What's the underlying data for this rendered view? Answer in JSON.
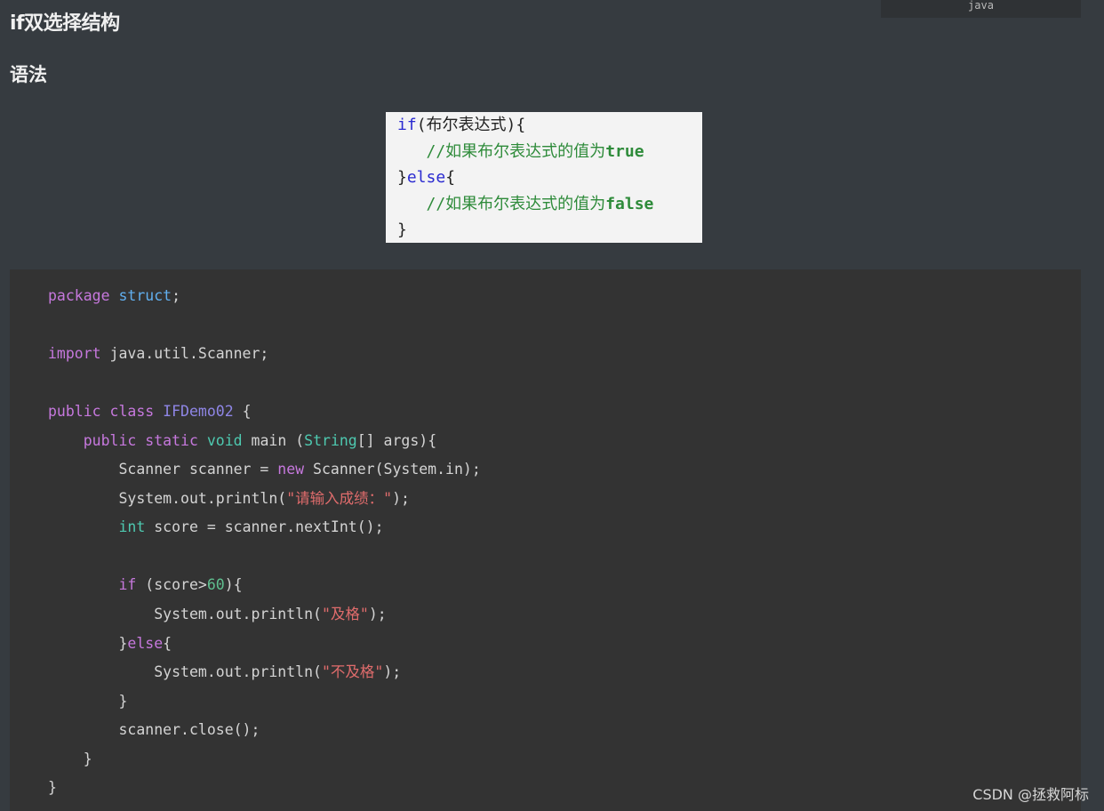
{
  "lang_label": "java",
  "heading": "if双选择结构",
  "subheading": "语法",
  "syntax_image": {
    "line1_kw": "if",
    "line1_rest": "(布尔表达式){",
    "line2_comment": "   //如果布尔表达式的值为",
    "line2_bold": "true",
    "line3_open": "}",
    "line3_kw": "else",
    "line3_rest": "{",
    "line4_comment": "   //如果布尔表达式的值为",
    "line4_bold": "false",
    "line5": "}"
  },
  "code": {
    "l1_kw": "package",
    "l1_name": "struct",
    "l1_end": ";",
    "l2_kw": "import",
    "l2_rest": " java.util.Scanner;",
    "l3_kw1": "public",
    "l3_kw2": "class",
    "l3_cls": "IFDemo02",
    "l3_end": " {",
    "l4_kw1": "public",
    "l4_kw2": "static",
    "l4_type": "void",
    "l4_mid": " main (",
    "l4_strtype": "String",
    "l4_end": "[] args){",
    "l5_a": "Scanner scanner = ",
    "l5_new": "new",
    "l5_b": " Scanner(System.in);",
    "l6_a": "System.out.println(",
    "l6_str": "\"请输入成绩：\"",
    "l6_b": ");",
    "l7_int": "int",
    "l7_rest": " score = scanner.nextInt();",
    "l8_if": "if",
    "l8_a": " (score>",
    "l8_num": "60",
    "l8_b": "){",
    "l9_a": "System.out.println(",
    "l9_str": "\"及格\"",
    "l9_b": ");",
    "l10_a": "}",
    "l10_else": "else",
    "l10_b": "{",
    "l11_a": "System.out.println(",
    "l11_str": "\"不及格\"",
    "l11_b": ");",
    "l12": "}",
    "l13": "scanner.close();",
    "l14": "}",
    "l15": "}"
  },
  "watermark": "CSDN @拯救阿标"
}
